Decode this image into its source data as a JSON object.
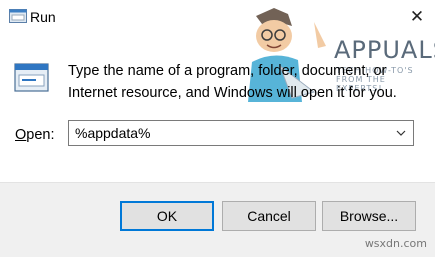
{
  "window": {
    "title": "Run",
    "close_glyph": "✕",
    "app_icon": "run-icon"
  },
  "dialog": {
    "message": "Type the name of a program, folder, document, or Internet resource, and Windows will open it for you.",
    "open_label_access_key": "O",
    "open_label_rest": "pen:",
    "input_value": "%appdata%",
    "icon": "run-dialog-icon"
  },
  "buttons": {
    "ok": "OK",
    "cancel": "Cancel",
    "browse": "Browse..."
  },
  "watermark": {
    "brand": "APPUALS",
    "tagline": "TECH HOW-TO'S FROM THE EXPERTS!",
    "site": "wsxdn.com"
  },
  "colors": {
    "footer_bg": "#f0f0f0",
    "button_bg": "#e1e1e1",
    "default_border": "#0078d7"
  }
}
